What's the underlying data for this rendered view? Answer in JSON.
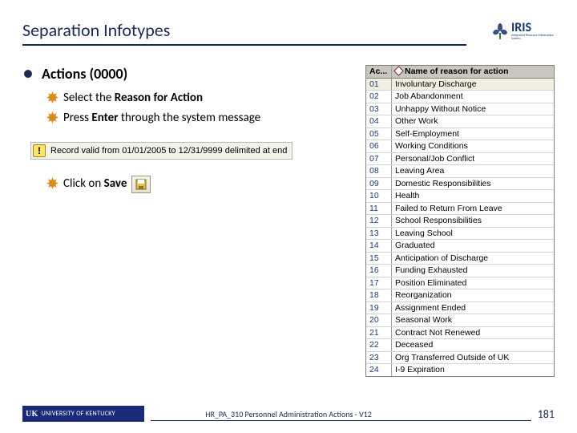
{
  "title": "Separation Infotypes",
  "logo": {
    "text": "IRIS",
    "sub": "Integrated Resource Information System"
  },
  "bullet": {
    "heading_prefix": "Actions",
    "heading_code": "(0000)"
  },
  "sub_items": {
    "a_pre": "Select the ",
    "a_bold": "Reason for Action",
    "b_pre": "Press ",
    "b_bold": "Enter",
    "b_post": " through the system message",
    "c_pre": "Click on ",
    "c_bold": "Save"
  },
  "system_message": "Record valid from 01/01/2005 to 12/31/9999 delimited at end",
  "table": {
    "col1": "Ac...",
    "col2": "Name of reason for action",
    "rows": [
      {
        "code": "01",
        "name": "Involuntary Discharge",
        "sel": true
      },
      {
        "code": "02",
        "name": "Job Abandonment"
      },
      {
        "code": "03",
        "name": "Unhappy Without Notice"
      },
      {
        "code": "04",
        "name": "Other Work"
      },
      {
        "code": "05",
        "name": "Self-Employment"
      },
      {
        "code": "06",
        "name": "Working Conditions"
      },
      {
        "code": "07",
        "name": "Personal/Job Conflict"
      },
      {
        "code": "08",
        "name": "Leaving Area"
      },
      {
        "code": "09",
        "name": "Domestic Responsibilities"
      },
      {
        "code": "10",
        "name": "Health"
      },
      {
        "code": "11",
        "name": "Failed to Return From Leave"
      },
      {
        "code": "12",
        "name": "School Responsibilities"
      },
      {
        "code": "13",
        "name": "Leaving School"
      },
      {
        "code": "14",
        "name": "Graduated"
      },
      {
        "code": "15",
        "name": "Anticipation of Discharge"
      },
      {
        "code": "16",
        "name": "Funding Exhausted"
      },
      {
        "code": "17",
        "name": "Position Eliminated"
      },
      {
        "code": "18",
        "name": "Reorganization"
      },
      {
        "code": "19",
        "name": "Assignment Ended"
      },
      {
        "code": "20",
        "name": "Seasonal Work"
      },
      {
        "code": "21",
        "name": "Contract Not Renewed"
      },
      {
        "code": "22",
        "name": "Deceased"
      },
      {
        "code": "23",
        "name": "Org Transferred Outside of UK"
      },
      {
        "code": "24",
        "name": "I-9 Expiration"
      }
    ]
  },
  "footer": {
    "org": "UNIVERSITY OF KENTUCKY",
    "badge": "UK",
    "doc": "HR_PA_310 Personnel Administration Actions - V12",
    "page": "181"
  }
}
